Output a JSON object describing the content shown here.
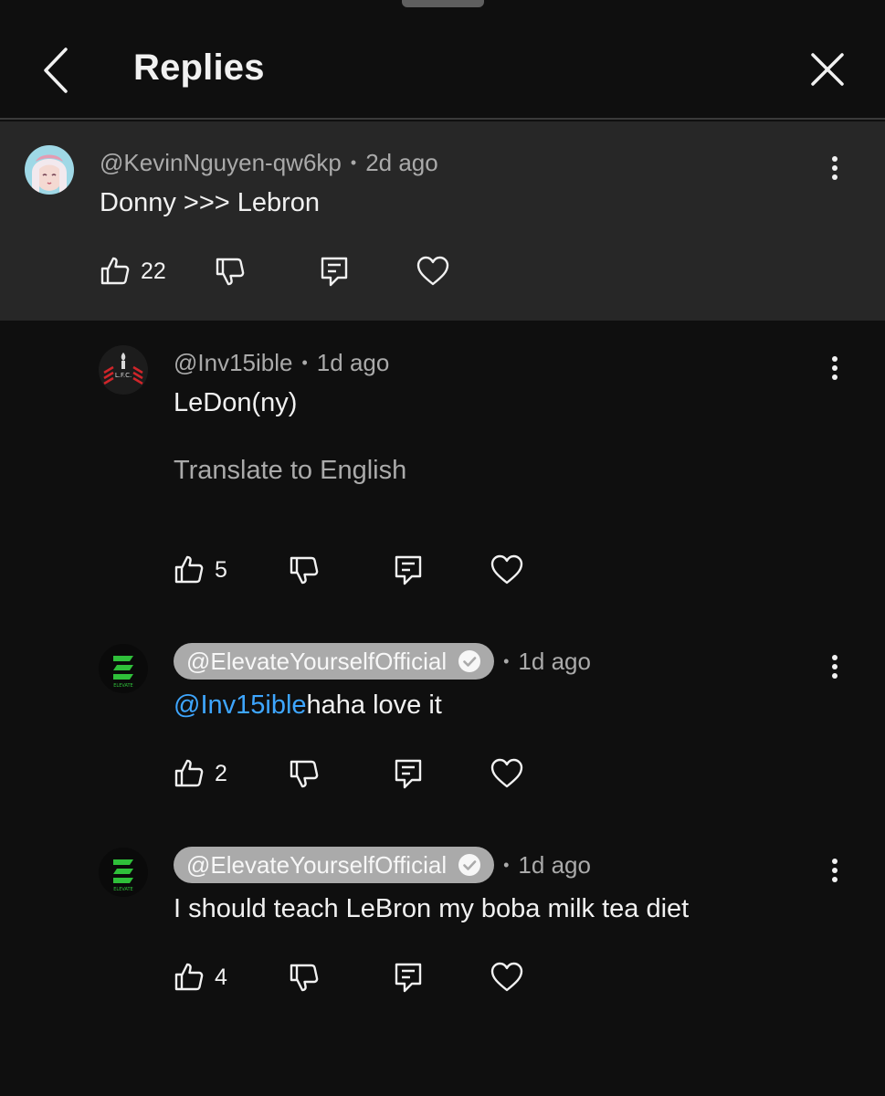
{
  "header": {
    "title": "Replies"
  },
  "comments": [
    {
      "handle": "@KevinNguyen-qw6kp",
      "time": "2d ago",
      "text": "Donny >>> Lebron",
      "likes": "22"
    },
    {
      "handle": "@Inv15ible",
      "time": "1d ago",
      "text": "LeDon(ny)",
      "translate": "Translate to English",
      "likes": "5"
    },
    {
      "handle": "@ElevateYourselfOfficial",
      "time": "1d ago",
      "mention": "@Inv15ible",
      "text": "haha love it",
      "likes": "2"
    },
    {
      "handle": "@ElevateYourselfOfficial",
      "time": "1d ago",
      "text": "I should teach LeBron my boba milk tea diet",
      "likes": "4"
    }
  ],
  "icons": {
    "back": "chevron-left-icon",
    "close": "close-icon",
    "more": "more-vertical-icon",
    "like": "thumb-up-icon",
    "dislike": "thumb-down-icon",
    "reply": "comment-icon",
    "heart": "heart-icon",
    "verified": "check-circle-icon"
  },
  "colors": {
    "background": "#0f0f0f",
    "highlight": "#272727",
    "mention": "#3ea6ff",
    "secondary_text": "#aaaaaa"
  }
}
